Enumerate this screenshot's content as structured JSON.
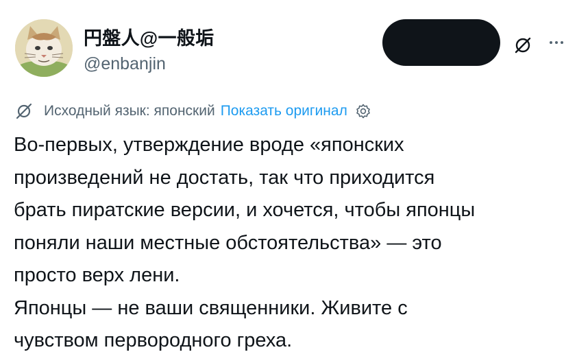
{
  "author": {
    "display_name": "円盤人@一般垢",
    "handle": "@enbanjin"
  },
  "translation": {
    "source_language": "Исходный язык: японский",
    "show_original_label": "Показать оригинал"
  },
  "icons": {
    "grok": "grok-icon",
    "more": "more-icon",
    "translate": "translate-icon",
    "settings": "gear-icon"
  },
  "colors": {
    "text": "#0f1419",
    "secondary": "#536471",
    "link": "#1d9bf0",
    "redacted": "#0f1419"
  },
  "tweet": {
    "lines": [
      "Во-первых, утверждение вроде «японских",
      "произведений не достать, так что приходится",
      "брать пиратские версии, и хочется, чтобы японцы",
      "поняли наши местные обстоятельства» — это",
      "просто верх лени.",
      "Японцы — не ваши священники. Живите с",
      "чувством первородного греха."
    ]
  }
}
